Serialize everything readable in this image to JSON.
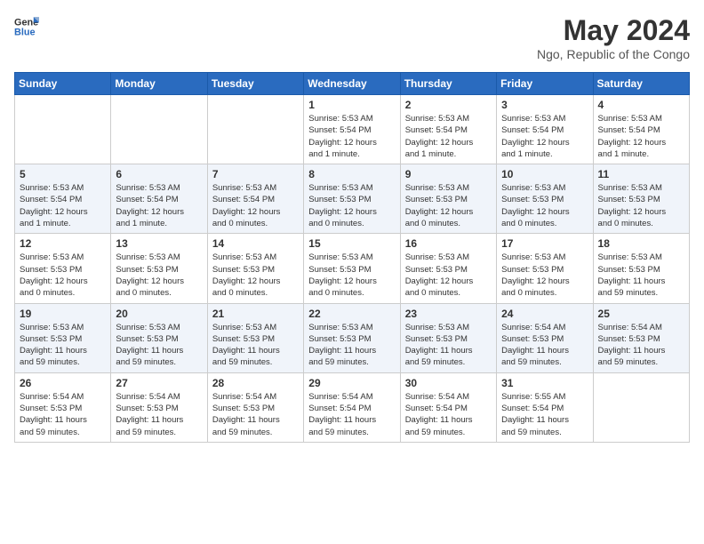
{
  "logo": {
    "line1": "General",
    "line2": "Blue"
  },
  "title": "May 2024",
  "location": "Ngo, Republic of the Congo",
  "weekdays": [
    "Sunday",
    "Monday",
    "Tuesday",
    "Wednesday",
    "Thursday",
    "Friday",
    "Saturday"
  ],
  "weeks": [
    [
      {
        "day": "",
        "info": ""
      },
      {
        "day": "",
        "info": ""
      },
      {
        "day": "",
        "info": ""
      },
      {
        "day": "1",
        "info": "Sunrise: 5:53 AM\nSunset: 5:54 PM\nDaylight: 12 hours\nand 1 minute."
      },
      {
        "day": "2",
        "info": "Sunrise: 5:53 AM\nSunset: 5:54 PM\nDaylight: 12 hours\nand 1 minute."
      },
      {
        "day": "3",
        "info": "Sunrise: 5:53 AM\nSunset: 5:54 PM\nDaylight: 12 hours\nand 1 minute."
      },
      {
        "day": "4",
        "info": "Sunrise: 5:53 AM\nSunset: 5:54 PM\nDaylight: 12 hours\nand 1 minute."
      }
    ],
    [
      {
        "day": "5",
        "info": "Sunrise: 5:53 AM\nSunset: 5:54 PM\nDaylight: 12 hours\nand 1 minute."
      },
      {
        "day": "6",
        "info": "Sunrise: 5:53 AM\nSunset: 5:54 PM\nDaylight: 12 hours\nand 1 minute."
      },
      {
        "day": "7",
        "info": "Sunrise: 5:53 AM\nSunset: 5:54 PM\nDaylight: 12 hours\nand 0 minutes."
      },
      {
        "day": "8",
        "info": "Sunrise: 5:53 AM\nSunset: 5:53 PM\nDaylight: 12 hours\nand 0 minutes."
      },
      {
        "day": "9",
        "info": "Sunrise: 5:53 AM\nSunset: 5:53 PM\nDaylight: 12 hours\nand 0 minutes."
      },
      {
        "day": "10",
        "info": "Sunrise: 5:53 AM\nSunset: 5:53 PM\nDaylight: 12 hours\nand 0 minutes."
      },
      {
        "day": "11",
        "info": "Sunrise: 5:53 AM\nSunset: 5:53 PM\nDaylight: 12 hours\nand 0 minutes."
      }
    ],
    [
      {
        "day": "12",
        "info": "Sunrise: 5:53 AM\nSunset: 5:53 PM\nDaylight: 12 hours\nand 0 minutes."
      },
      {
        "day": "13",
        "info": "Sunrise: 5:53 AM\nSunset: 5:53 PM\nDaylight: 12 hours\nand 0 minutes."
      },
      {
        "day": "14",
        "info": "Sunrise: 5:53 AM\nSunset: 5:53 PM\nDaylight: 12 hours\nand 0 minutes."
      },
      {
        "day": "15",
        "info": "Sunrise: 5:53 AM\nSunset: 5:53 PM\nDaylight: 12 hours\nand 0 minutes."
      },
      {
        "day": "16",
        "info": "Sunrise: 5:53 AM\nSunset: 5:53 PM\nDaylight: 12 hours\nand 0 minutes."
      },
      {
        "day": "17",
        "info": "Sunrise: 5:53 AM\nSunset: 5:53 PM\nDaylight: 12 hours\nand 0 minutes."
      },
      {
        "day": "18",
        "info": "Sunrise: 5:53 AM\nSunset: 5:53 PM\nDaylight: 11 hours\nand 59 minutes."
      }
    ],
    [
      {
        "day": "19",
        "info": "Sunrise: 5:53 AM\nSunset: 5:53 PM\nDaylight: 11 hours\nand 59 minutes."
      },
      {
        "day": "20",
        "info": "Sunrise: 5:53 AM\nSunset: 5:53 PM\nDaylight: 11 hours\nand 59 minutes."
      },
      {
        "day": "21",
        "info": "Sunrise: 5:53 AM\nSunset: 5:53 PM\nDaylight: 11 hours\nand 59 minutes."
      },
      {
        "day": "22",
        "info": "Sunrise: 5:53 AM\nSunset: 5:53 PM\nDaylight: 11 hours\nand 59 minutes."
      },
      {
        "day": "23",
        "info": "Sunrise: 5:53 AM\nSunset: 5:53 PM\nDaylight: 11 hours\nand 59 minutes."
      },
      {
        "day": "24",
        "info": "Sunrise: 5:54 AM\nSunset: 5:53 PM\nDaylight: 11 hours\nand 59 minutes."
      },
      {
        "day": "25",
        "info": "Sunrise: 5:54 AM\nSunset: 5:53 PM\nDaylight: 11 hours\nand 59 minutes."
      }
    ],
    [
      {
        "day": "26",
        "info": "Sunrise: 5:54 AM\nSunset: 5:53 PM\nDaylight: 11 hours\nand 59 minutes."
      },
      {
        "day": "27",
        "info": "Sunrise: 5:54 AM\nSunset: 5:53 PM\nDaylight: 11 hours\nand 59 minutes."
      },
      {
        "day": "28",
        "info": "Sunrise: 5:54 AM\nSunset: 5:53 PM\nDaylight: 11 hours\nand 59 minutes."
      },
      {
        "day": "29",
        "info": "Sunrise: 5:54 AM\nSunset: 5:54 PM\nDaylight: 11 hours\nand 59 minutes."
      },
      {
        "day": "30",
        "info": "Sunrise: 5:54 AM\nSunset: 5:54 PM\nDaylight: 11 hours\nand 59 minutes."
      },
      {
        "day": "31",
        "info": "Sunrise: 5:55 AM\nSunset: 5:54 PM\nDaylight: 11 hours\nand 59 minutes."
      },
      {
        "day": "",
        "info": ""
      }
    ]
  ]
}
